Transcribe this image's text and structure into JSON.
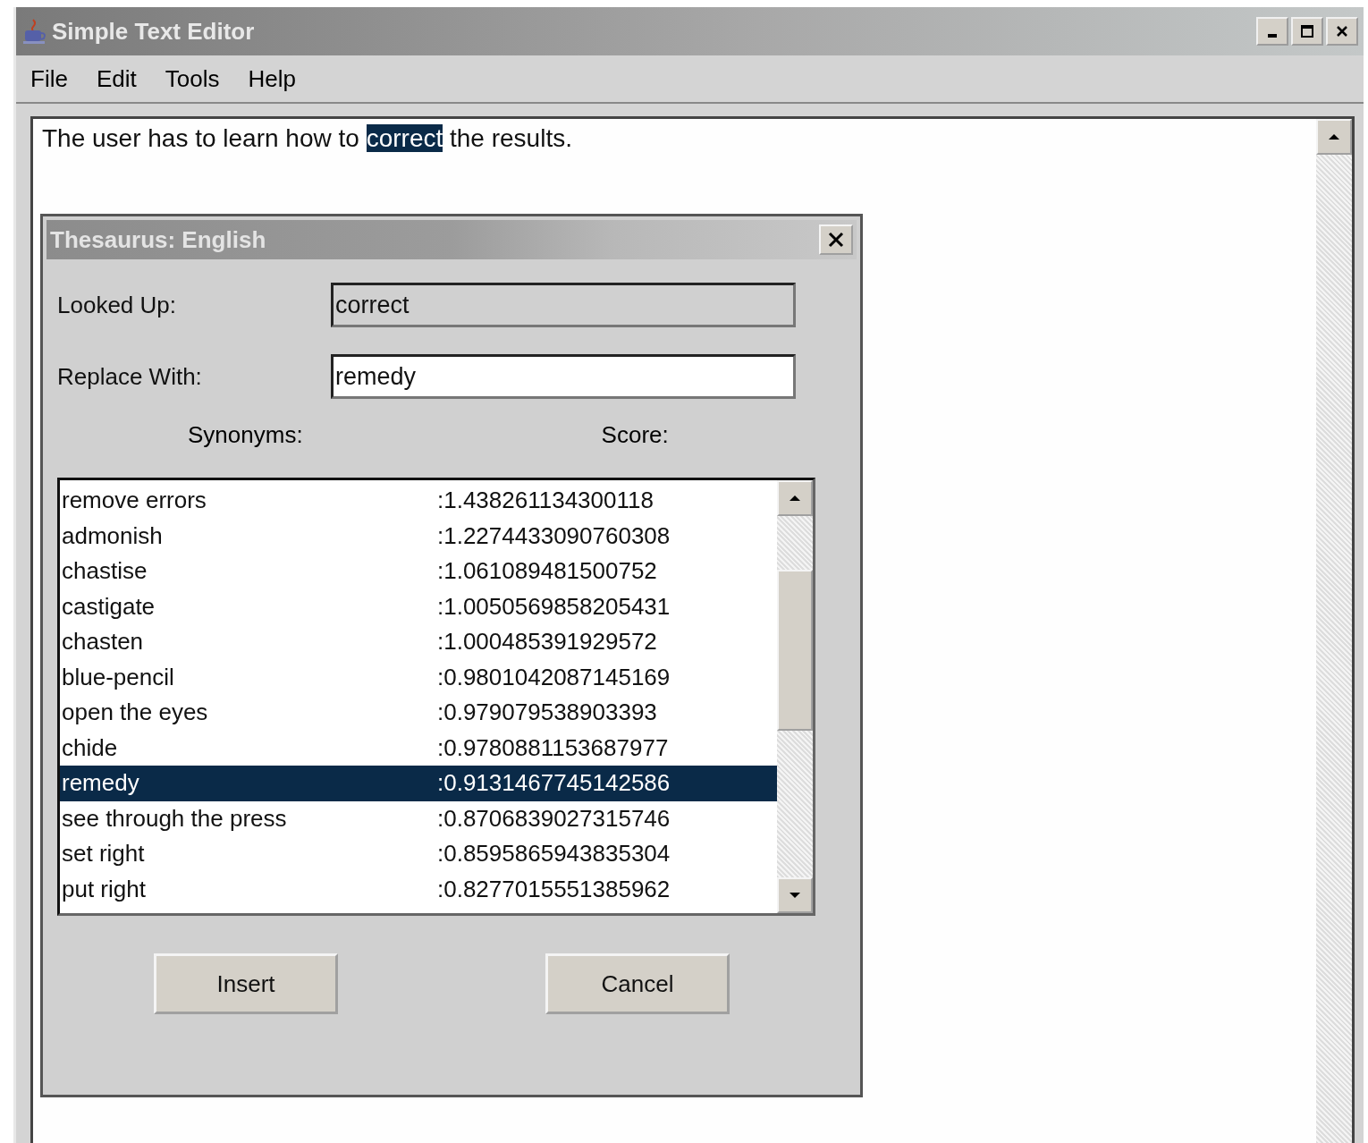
{
  "window": {
    "title": "Simple Text Editor"
  },
  "menu": [
    "File",
    "Edit",
    "Tools",
    "Help"
  ],
  "editor": {
    "runs": [
      {
        "text": "The user has to learn how to ",
        "selected": false
      },
      {
        "text": "correct",
        "selected": true
      },
      {
        "text": " the results.",
        "selected": false
      }
    ]
  },
  "dialog": {
    "title": "Thesaurus: English",
    "fields": [
      {
        "label": "Looked Up:",
        "value": "correct",
        "disabled": true
      },
      {
        "label": "Replace With:",
        "value": "remedy",
        "disabled": false
      }
    ],
    "columns": [
      "Synonyms:",
      "Score:"
    ],
    "rows": [
      {
        "synonym": "remove errors",
        "score": ":1.438261134300118",
        "selected": false
      },
      {
        "synonym": "admonish",
        "score": ":1.2274433090760308",
        "selected": false
      },
      {
        "synonym": "chastise",
        "score": ":1.061089481500752",
        "selected": false
      },
      {
        "synonym": "castigate",
        "score": ":1.0050569858205431",
        "selected": false
      },
      {
        "synonym": "chasten",
        "score": ":1.000485391929572",
        "selected": false
      },
      {
        "synonym": "blue-pencil",
        "score": ":0.9801042087145169",
        "selected": false
      },
      {
        "synonym": "open the eyes",
        "score": ":0.979079538903393",
        "selected": false
      },
      {
        "synonym": "chide",
        "score": ":0.9780881153687977",
        "selected": false
      },
      {
        "synonym": "remedy",
        "score": ":0.9131467745142586",
        "selected": true
      },
      {
        "synonym": "see through the press",
        "score": ":0.8706839027315746",
        "selected": false
      },
      {
        "synonym": "set right",
        "score": ":0.8595865943835304",
        "selected": false
      },
      {
        "synonym": "put right",
        "score": ":0.8277015551385962",
        "selected": false
      }
    ],
    "buttons": [
      "Insert",
      "Cancel"
    ]
  }
}
